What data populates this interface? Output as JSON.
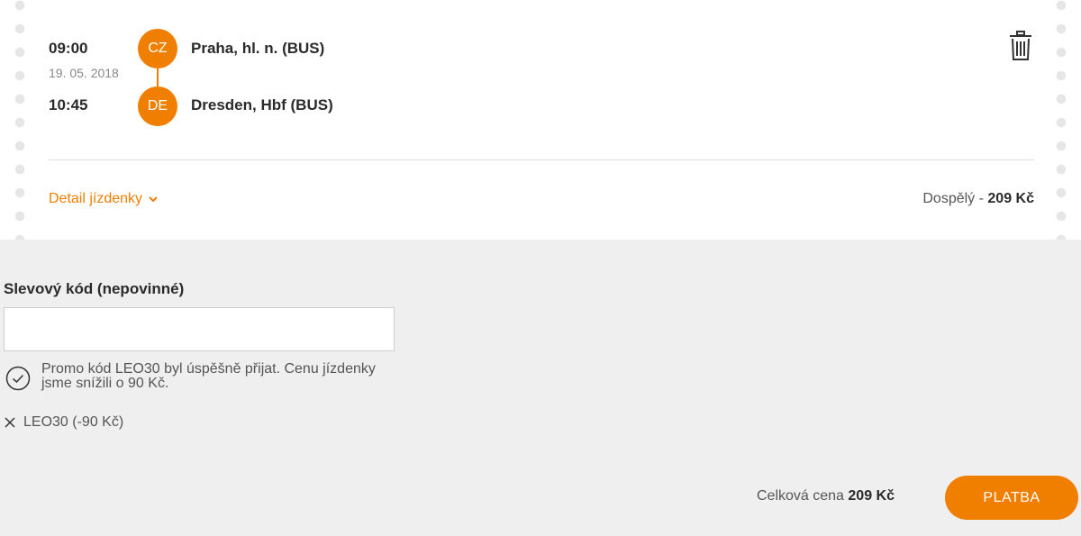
{
  "ticket": {
    "departure": {
      "time": "09:00",
      "date": "19. 05. 2018",
      "country": "CZ",
      "station": "Praha, hl. n. (BUS)"
    },
    "arrival": {
      "time": "10:45",
      "country": "DE",
      "station": "Dresden, Hbf (BUS)"
    },
    "detail_link": "Detail jízdenky",
    "passenger_type": "Dospělý",
    "passenger_sep": " - ",
    "price": "209 Kč"
  },
  "promo": {
    "label": "Slevový kód (nepovinné)",
    "input_value": "",
    "success_message": "Promo kód LEO30 byl úspěšně přijat. Cenu jízdenky jsme snížili o 90 Kč.",
    "applied_code": "LEO30 (-90 Kč)"
  },
  "footer": {
    "total_label": "Celková cena",
    "total_value": "209 Kč",
    "pay_button": "PLATBA"
  },
  "colors": {
    "accent": "#f07f00",
    "background": "#efefef",
    "card": "#ffffff"
  }
}
